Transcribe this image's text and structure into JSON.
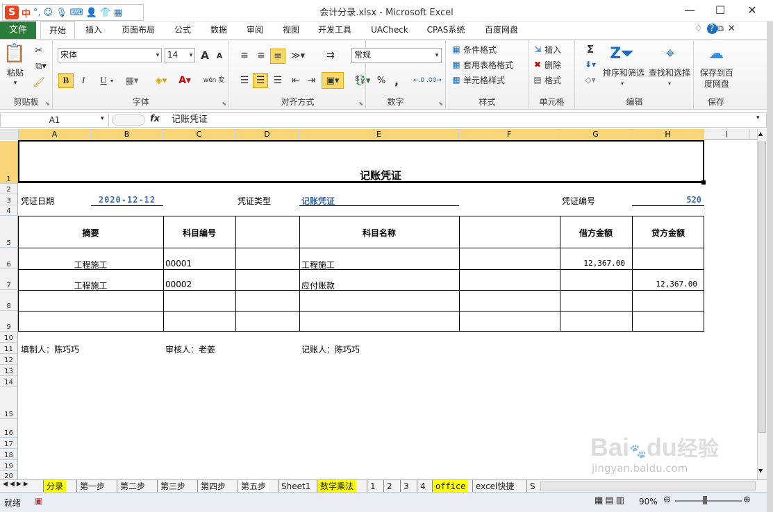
{
  "ime": {
    "logo": "S",
    "lang": "中",
    "punct": "°,",
    "icons": [
      "smile-icon",
      "mic-icon",
      "keyboard-icon",
      "user-icon",
      "shirt-icon",
      "grid-icon"
    ]
  },
  "window": {
    "title": "会计分录.xlsx - Microsoft Excel",
    "min": "—",
    "max": "☐",
    "close": "✕"
  },
  "ribbon_tabs": [
    "文件",
    "开始",
    "插入",
    "页面布局",
    "公式",
    "数据",
    "审阅",
    "视图",
    "开发工具",
    "UACheck",
    "CPAS系统",
    "百度网盘"
  ],
  "active_tab": "开始",
  "groups": {
    "clipboard": "剪贴板",
    "font": "字体",
    "align": "对齐方式",
    "number": "数字",
    "style": "样式",
    "cells": "单元格",
    "edit": "编辑",
    "save": "保存"
  },
  "clipboard": {
    "paste": "粘贴"
  },
  "font": {
    "name": "宋体",
    "size": "14",
    "bold": "B",
    "italic": "I",
    "underline": "U",
    "grow": "A",
    "shrink": "A",
    "wen": "wén 变"
  },
  "number": {
    "format": "常规",
    "percent": "%",
    "comma": ","
  },
  "styles": {
    "cond": "条件格式",
    "table": "套用表格格式",
    "cell": "单元格样式"
  },
  "cells": {
    "insert": "插入",
    "delete": "删除",
    "format": "格式"
  },
  "edit": {
    "sum": "Σ",
    "sort": "排序和筛选",
    "find": "查找和选择"
  },
  "save": {
    "label": "保存到百度网盘"
  },
  "formula_bar": {
    "namebox": "A1",
    "fx": "fx",
    "content": "记账凭证"
  },
  "columns": [
    "A",
    "B",
    "C",
    "D",
    "E",
    "F",
    "G",
    "H",
    "I"
  ],
  "rows": [
    "1",
    "2",
    "3",
    "4",
    "5",
    "6",
    "7",
    "8",
    "9",
    "10",
    "11",
    "12",
    "13",
    "14",
    "15",
    "16",
    "17",
    "18",
    "19",
    "20"
  ],
  "voucher": {
    "title": "记账凭证",
    "date_label": "凭证日期",
    "date": "2020-12-12",
    "type_label": "凭证类型",
    "type": "记账凭证",
    "no_label": "凭证编号",
    "no": "520",
    "headers": [
      "摘要",
      "科目编号",
      "",
      "科目名称",
      "",
      "借方金额",
      "贷方金额"
    ],
    "rows": [
      {
        "summary": "工程施工",
        "code": "00001",
        "name": "工程施工",
        "debit": "12,367.00",
        "credit": ""
      },
      {
        "summary": "工程施工",
        "code": "00002",
        "name": "应付账款",
        "debit": "",
        "credit": "12,367.00"
      }
    ],
    "preparer": "填制人：陈巧巧",
    "reviewer": "审核人：老姜",
    "bookkeeper": "记账人：陈巧巧"
  },
  "sheet_tabs": [
    "分录",
    "第一步",
    "第二步",
    "第三步",
    "第四步",
    "第五步",
    "Sheet1",
    "数学乘法",
    "1",
    "2",
    "3",
    "4",
    "office",
    "excel快捷",
    "S"
  ],
  "status": {
    "mode": "就绪",
    "zoom": "90%"
  },
  "watermark": {
    "brand": "Bai",
    "du": "du",
    "site": "经验",
    "url": "jingyan.baidu.com"
  }
}
